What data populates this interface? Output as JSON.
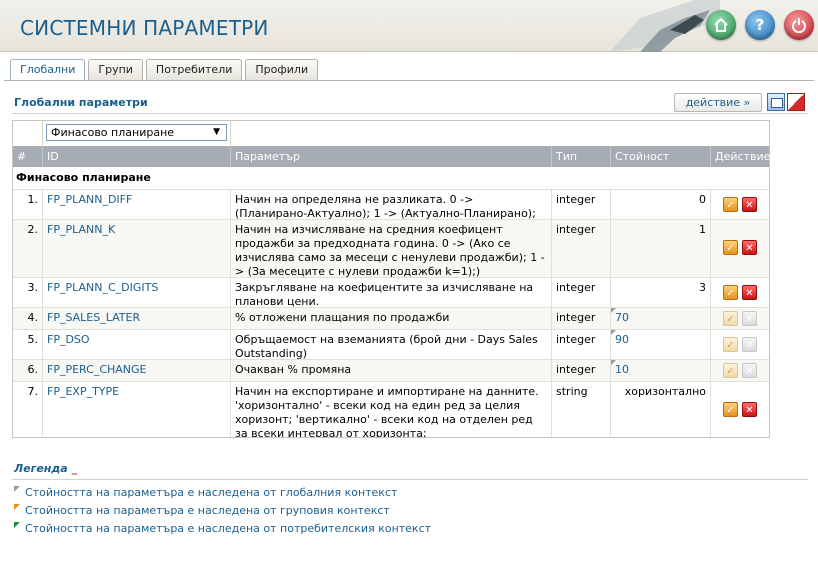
{
  "header": {
    "title": "СИСТЕМНИ ПАРАМЕТРИ"
  },
  "tabs": [
    {
      "label": "Глобални",
      "active": true
    },
    {
      "label": "Групи",
      "active": false
    },
    {
      "label": "Потребители",
      "active": false
    },
    {
      "label": "Профили",
      "active": false
    }
  ],
  "section": {
    "title": "Глобални параметри",
    "action_label": "действие »"
  },
  "filter": {
    "selected": "Финасово планиране"
  },
  "columns": [
    "#",
    "ID",
    "Параметър",
    "Тип",
    "Стойност",
    "Действие"
  ],
  "group": {
    "label": "Финасово планиране"
  },
  "rows": [
    {
      "num": "1.",
      "id": "FP_PLANN_DIFF",
      "param": "Начин на определяна не разликата. 0 -> (Планирано-Актуално); 1 -> (Актуално-Планирано);",
      "type": "integer",
      "value": "0",
      "editable": true
    },
    {
      "num": "2.",
      "id": "FP_PLANN_K",
      "param": "Начин на изчисляване на средния коефицент продажби за предходната година. 0 -> (Ако се изчислява само за месеци с ненулеви продажби); 1 -> (За месеците с нулеви продажби k=1);)",
      "type": "integer",
      "value": "1",
      "editable": true
    },
    {
      "num": "3.",
      "id": "FP_PLANN_C_DIGITS",
      "param": "Закръгляване на коефицентите за изчисляване на планови цени.",
      "type": "integer",
      "value": "3",
      "editable": true
    },
    {
      "num": "4.",
      "id": "FP_SALES_LATER",
      "param": "% отложени плащания по продажби",
      "type": "integer",
      "value": "70",
      "editable": false
    },
    {
      "num": "5.",
      "id": "FP_DSO",
      "param": "Обръщаемост на вземанията (брой дни - Days Sales Outstanding)",
      "type": "integer",
      "value": "90",
      "editable": false
    },
    {
      "num": "6.",
      "id": "FP_PERC_CHANGE",
      "param": "Очакван % промяна",
      "type": "integer",
      "value": "10",
      "editable": false
    },
    {
      "num": "7.",
      "id": "FP_EXP_TYPE",
      "param": "Начин на експортиране и импортиране на данните. 'хоризонтално' - всеки код на един ред за целия хоризонт; 'вертикално' - всеки код на отделен ред за всеки интервал от хоризонта;",
      "type": "string",
      "value": "хоризонтално",
      "editable": true
    }
  ],
  "legend": {
    "title": "Легенда",
    "items": [
      {
        "text": "Стойността на параметъра е наследена от глобалния контекст",
        "color": "#9a9a9a"
      },
      {
        "text": "Стойността на параметъра е наследена от груповия контекст",
        "color": "#e8901c"
      },
      {
        "text": "Стойността на параметъра е наследена от потребителския контекст",
        "color": "#1f8f3a"
      }
    ]
  },
  "colors": {
    "accent": "#1b5f8f",
    "header_bg": "#a5acb4",
    "danger": "#c81515",
    "edit": "#e8901c"
  }
}
